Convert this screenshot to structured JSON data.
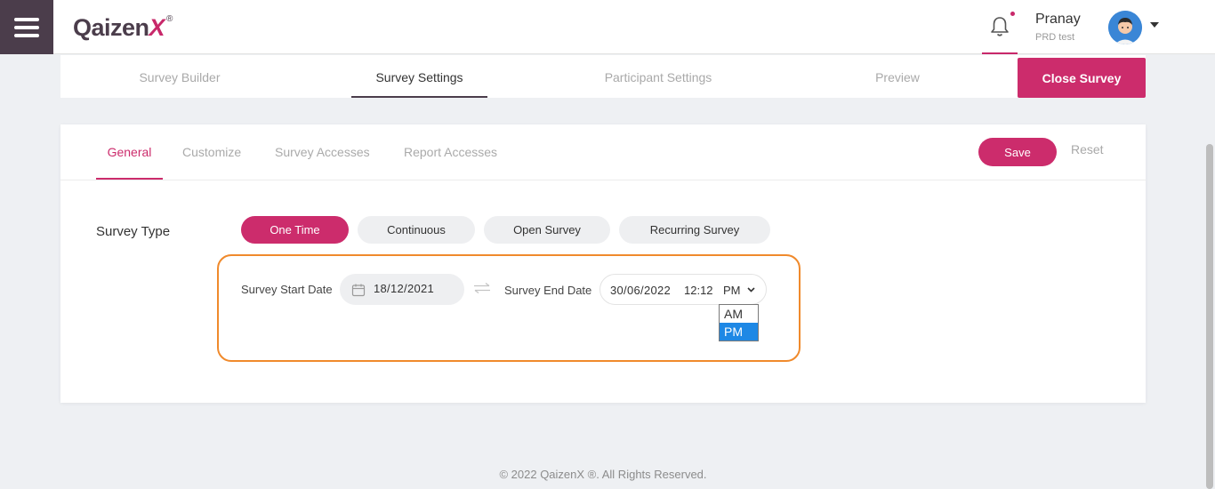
{
  "header": {
    "logo_text": "Qaizen",
    "logo_x": "X",
    "logo_reg": "®",
    "user_name": "Pranay",
    "user_org": "PRD test",
    "icons": [
      "menu-icon",
      "bell-icon",
      "avatar",
      "chevron-down-icon"
    ],
    "accent_color": "#cc2c6c"
  },
  "steps": {
    "items": [
      "Survey Builder",
      "Survey Settings",
      "Participant Settings",
      "Preview"
    ],
    "active": "Survey Settings",
    "close_label": "Close Survey"
  },
  "settings": {
    "tabs": [
      "General",
      "Customize",
      "Survey Accesses",
      "Report Accesses"
    ],
    "active_tab": "General",
    "save_label": "Save",
    "reset_label": "Reset",
    "survey_type_label": "Survey Type",
    "survey_types": [
      "One Time",
      "Continuous",
      "Open Survey",
      "Recurring Survey"
    ],
    "selected_type": "One Time",
    "start_label": "Survey Start Date",
    "start_value": "18/12/2021",
    "end_label": "Survey End Date",
    "end_date": "30/06/2022",
    "end_time": "12:12",
    "end_ampm": "PM",
    "ampm_options": [
      "AM",
      "PM"
    ]
  },
  "footer": {
    "text": "© 2022 QaizenX ®. All Rights Reserved."
  }
}
